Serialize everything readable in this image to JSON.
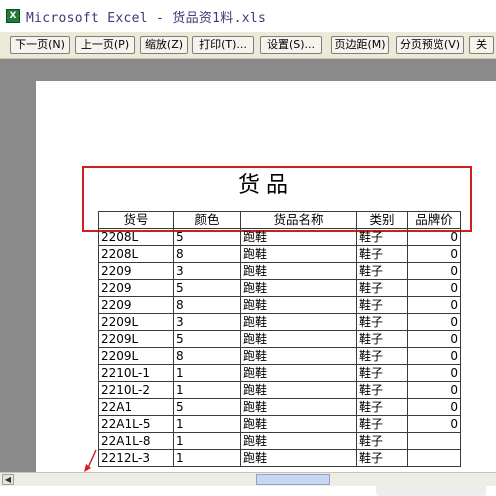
{
  "window": {
    "title": "Microsoft Excel - 货品资1料.xls"
  },
  "toolbar": {
    "buttons": [
      "下一页(N)",
      "上一页(P)",
      "缩放(Z)",
      "打印(T)...",
      "设置(S)...",
      "页边距(M)",
      "分页预览(V)",
      "关"
    ]
  },
  "document": {
    "title": "货品"
  },
  "sheet": {
    "headers": [
      "货号",
      "颜色",
      "货品名称",
      "类别",
      "品牌价"
    ],
    "rows": [
      [
        "2208L",
        "5",
        "跑鞋",
        "鞋子",
        "0"
      ],
      [
        "2208L",
        "8",
        "跑鞋",
        "鞋子",
        "0"
      ],
      [
        "2209",
        "3",
        "跑鞋",
        "鞋子",
        "0"
      ],
      [
        "2209",
        "5",
        "跑鞋",
        "鞋子",
        "0"
      ],
      [
        "2209",
        "8",
        "跑鞋",
        "鞋子",
        "0"
      ],
      [
        "2209L",
        "3",
        "跑鞋",
        "鞋子",
        "0"
      ],
      [
        "2209L",
        "5",
        "跑鞋",
        "鞋子",
        "0"
      ],
      [
        "2209L",
        "8",
        "跑鞋",
        "鞋子",
        "0"
      ],
      [
        "2210L-1",
        "1",
        "跑鞋",
        "鞋子",
        "0"
      ],
      [
        "2210L-2",
        "1",
        "跑鞋",
        "鞋子",
        "0"
      ],
      [
        "22A1",
        "5",
        "跑鞋",
        "鞋子",
        "0"
      ],
      [
        "22A1L-5",
        "1",
        "跑鞋",
        "鞋子",
        "0"
      ],
      [
        "22A1L-8",
        "1",
        "跑鞋",
        "鞋子",
        ""
      ],
      [
        "2212L-3",
        "1",
        "跑鞋",
        "鞋子",
        ""
      ]
    ]
  },
  "colors": {
    "highlight": "#cc1f1f",
    "workspace": "#8a8a8a",
    "toolbar": "#ece9d8"
  },
  "icons": {
    "app": "excel-icon",
    "scroll_left": "scroll-left-arrow-icon",
    "annotation": "red-arrow-icon"
  }
}
